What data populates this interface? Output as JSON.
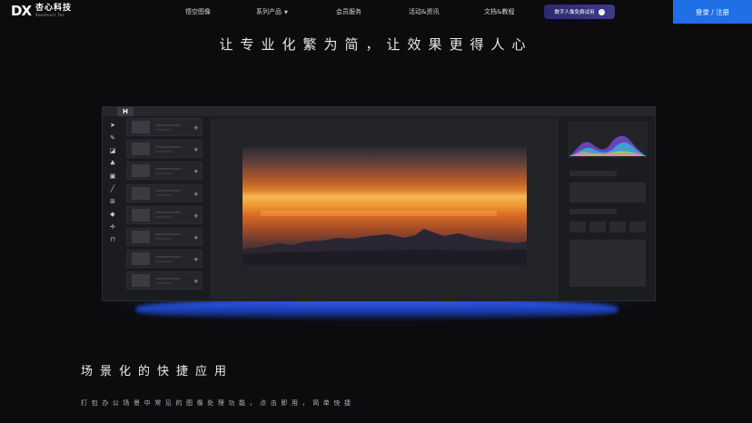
{
  "nav": {
    "logo_mark": "DX",
    "logo_cn": "杏心科技",
    "logo_en": "XeeHeart Tec",
    "items": [
      "悟空图像",
      "系列产品",
      "会员服务",
      "活动&资讯",
      "文档&教程"
    ],
    "dropdown_icon": "chevron-down-icon",
    "pill_label": "数字人像免费试用",
    "pill_icon": "arrow-right-icon",
    "login_label": "登录 / 注册",
    "login_color": "#1f6fe5"
  },
  "hero": {
    "title": "让专业化繁为简，让效果更得人心"
  },
  "app_preview": {
    "logo": "H",
    "tools": [
      "arrow-icon",
      "brush-icon",
      "eraser-icon",
      "stamp-icon",
      "image-icon",
      "pen-icon",
      "text-icon",
      "fill-icon",
      "crop-icon",
      "shape-icon"
    ]
  },
  "section": {
    "title": "场景化的快捷应用",
    "description": "打包办公场景中常见的图像处理功能，点击即用，简单快捷"
  }
}
